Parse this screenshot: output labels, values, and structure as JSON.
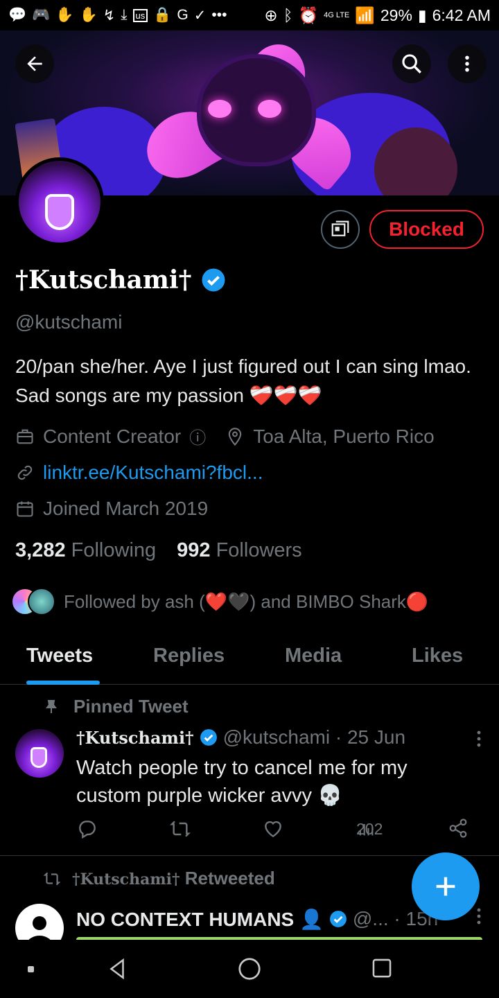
{
  "status_bar": {
    "battery": "29%",
    "time": "6:42 AM",
    "network": "4G LTE"
  },
  "header": {
    "back_icon": "arrow-left-icon",
    "search_icon": "search-icon",
    "more_icon": "more-vertical-icon"
  },
  "profile": {
    "display_name": "†Kutschami†",
    "handle": "@kutschami",
    "bio": "20/pan she/her. Aye I just figured out I can sing lmao. Sad songs are my passion ❤️‍🩹❤️‍🩹❤️‍🩹",
    "category": "Content Creator",
    "location": "Toa Alta, Puerto Rico",
    "link": "linktr.ee/Kutschami?fbcl...",
    "joined": "Joined March 2019",
    "following_count": "3,282",
    "following_label": "Following",
    "followers_count": "992",
    "followers_label": "Followers",
    "followed_by": "Followed by ash (❤️🖤) and BIMBO Shark🔴",
    "blocked_label": "Blocked"
  },
  "tabs": [
    "Tweets",
    "Replies",
    "Media",
    "Likes"
  ],
  "pinned_tweet": {
    "label": "Pinned Tweet",
    "name": "†Kutschami†",
    "handle_time": "@kutschami · 25 Jun",
    "text": "Watch people try to cancel me for my custom purple wicker avvy 💀",
    "views": "202"
  },
  "retweet": {
    "label_name": "†Kutschami†",
    "label_suffix": "Retweeted",
    "name": "NO CONTEXT HUMANS 👤",
    "handle_time": "@... · 15h"
  },
  "colors": {
    "accent": "#1d9bf0",
    "blocked": "#f4212e",
    "muted": "#71767b"
  }
}
